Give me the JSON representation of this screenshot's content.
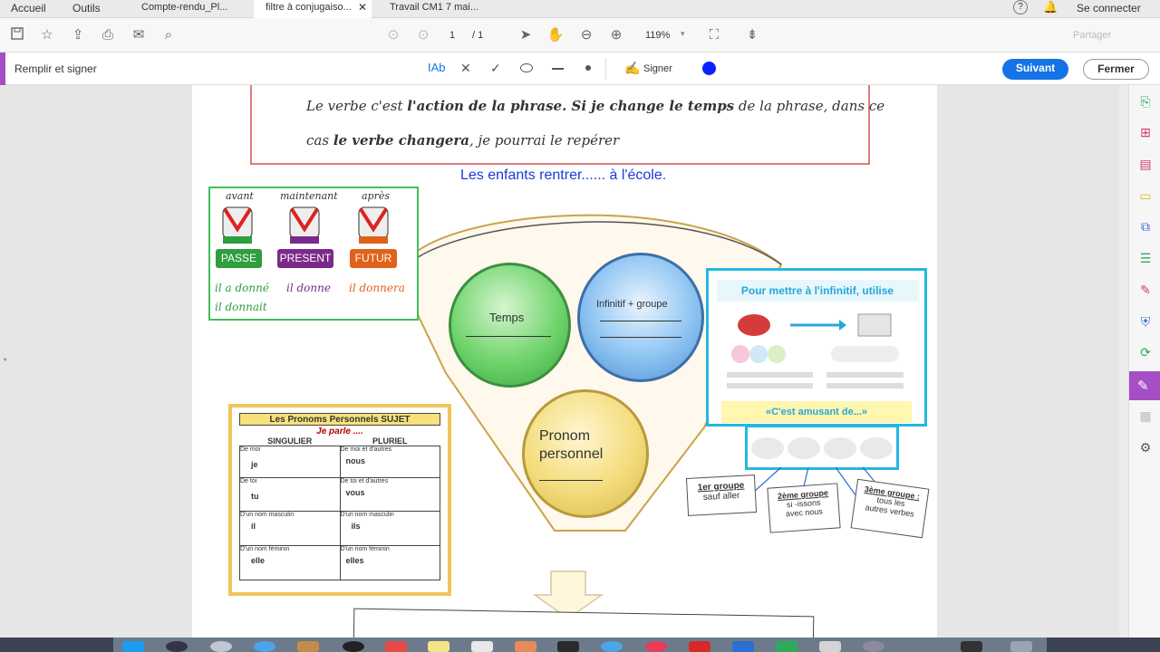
{
  "menu": {
    "home": "Accueil",
    "tools": "Outils"
  },
  "tabs": [
    {
      "label": "Compte-rendu_Pl..."
    },
    {
      "label": "filtre à conjugaiso..."
    },
    {
      "label": "Travail CM1 7 mai..."
    }
  ],
  "account": {
    "sign_in": "Se connecter"
  },
  "toolbar": {
    "page_current": "1",
    "page_total": "/ 1",
    "zoom": "119%",
    "share": "Partager"
  },
  "fill_sign": {
    "title": "Remplir et signer",
    "sign_label": "Signer",
    "next_label": "Suivant",
    "close_label": "Fermer",
    "text_tool": "Ab",
    "ink_color": "#0a23ff"
  },
  "document": {
    "rule_line1_a": "Le verbe c'est ",
    "rule_line1_b": "l'action de la phrase. Si je change le temps",
    "rule_line1_c": " de la phrase, dans ce",
    "rule_line2_a": "cas ",
    "rule_line2_b": "le verbe changera",
    "rule_line2_c": ", je pourrai le repérer",
    "exercise": "Les enfants rentrer......  à l'école.",
    "tenses": {
      "before": "avant",
      "now": "maintenant",
      "after": "après",
      "past": "PASSE",
      "present": "PRESENT",
      "future": "FUTUR",
      "ex_past": "il a donné",
      "ex_present": "il donne",
      "ex_future": "il donnera",
      "ex_imperfect": "il donnait"
    },
    "circles": {
      "tense": "Temps",
      "infinitive": "Infinitif + groupe",
      "pronoun_l1": "Pronom",
      "pronoun_l2": "personnel"
    },
    "infinitive_box": {
      "title": "Pour mettre à l'infinitif, utilise",
      "tagline": "«C'est amusant de...»"
    },
    "groups": {
      "g1_title": "1er groupe",
      "g1_text": "sauf aller",
      "g2_title": "2ème groupe",
      "g2_text_1": "si -issons",
      "g2_text_2": "avec nous",
      "g3_title": "3ème groupe :",
      "g3_text_1": "tous les",
      "g3_text_2": "autres verbes"
    },
    "pronouns": {
      "title": "Les Pronoms Personnels SUJET",
      "subtitle": "Je parle ....",
      "col_singular": "SINGULIER",
      "col_plural": "PLURIEL",
      "rows": [
        {
          "s_desc": "De moi",
          "s_pron": "je",
          "p_desc": "De moi et d'autres",
          "p_pron": "nous"
        },
        {
          "s_desc": "De toi",
          "s_pron": "tu",
          "p_desc": "De toi et d'autres",
          "p_pron": "vous"
        },
        {
          "s_desc": "D'un nom masculin",
          "s_pron": "il",
          "p_desc": "D'un nom masculin",
          "p_pron": "ils"
        },
        {
          "s_desc": "D'un nom féminin",
          "s_pron": "elle",
          "p_desc": "D'un nom féminin",
          "p_pron": "elles"
        }
      ]
    }
  },
  "colors": {
    "accent_blue": "#1473e6",
    "past_green": "#2e9e3e",
    "present_purple": "#7a2a8a",
    "future_orange": "#e0621a"
  }
}
